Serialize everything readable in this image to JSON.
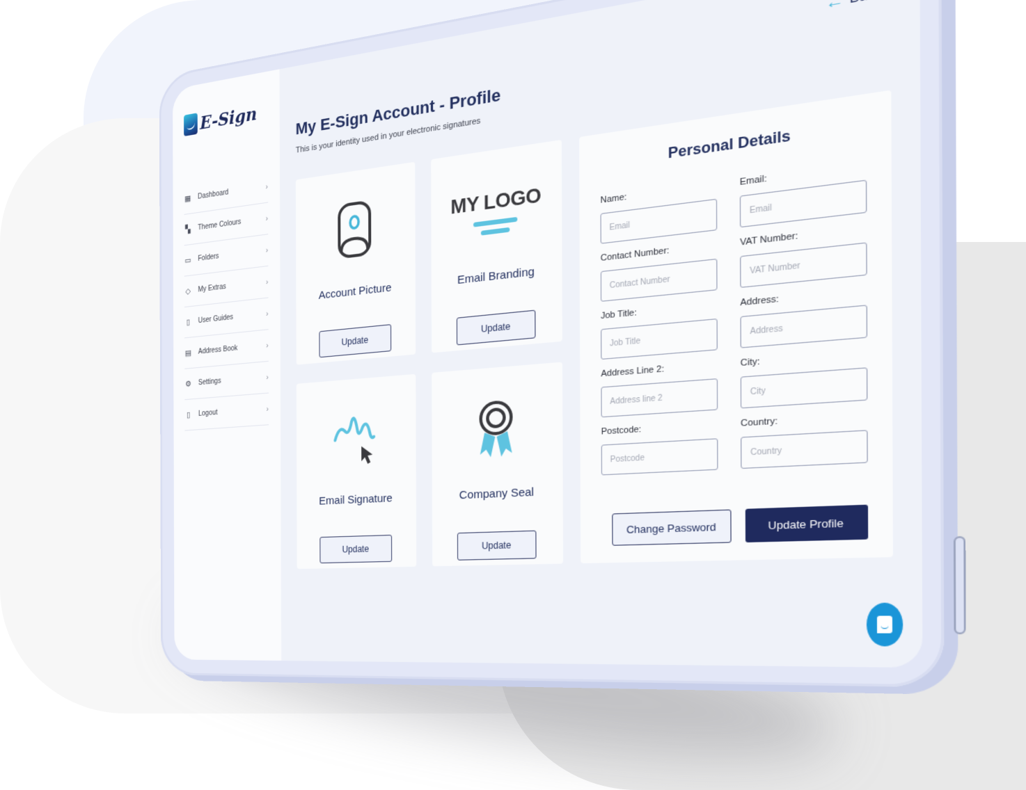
{
  "app": {
    "logo_text": "E-Sign"
  },
  "sidebar": {
    "items": [
      {
        "label": "Dashboard",
        "icon": "dashboard-icon"
      },
      {
        "label": "Theme Colours",
        "icon": "palette-icon"
      },
      {
        "label": "Folders",
        "icon": "folder-icon"
      },
      {
        "label": "My Extras",
        "icon": "tag-icon"
      },
      {
        "label": "User Guides",
        "icon": "book-icon"
      },
      {
        "label": "Address Book",
        "icon": "address-book-icon"
      },
      {
        "label": "Settings",
        "icon": "gear-icon"
      },
      {
        "label": "Logout",
        "icon": "logout-icon"
      }
    ]
  },
  "header": {
    "back_label": "Back",
    "title": "My E-Sign Account - Profile",
    "subtitle": "This is your identity used in your electronic signatures"
  },
  "cards": [
    {
      "title": "Account Picture",
      "button": "Update",
      "icon": "account-picture-icon"
    },
    {
      "title": "Email Branding",
      "button": "Update",
      "icon": "logo-icon",
      "logo_text": "MY LOGO"
    },
    {
      "title": "Email Signature",
      "button": "Update",
      "icon": "signature-icon"
    },
    {
      "title": "Company Seal",
      "button": "Update",
      "icon": "seal-icon"
    }
  ],
  "personal_details": {
    "title": "Personal Details",
    "fields": [
      {
        "label": "Name:",
        "placeholder": "Email",
        "value": ""
      },
      {
        "label": "Email:",
        "placeholder": "Email",
        "value": ""
      },
      {
        "label": "Contact Number:",
        "placeholder": "Contact Number",
        "value": ""
      },
      {
        "label": "VAT Number:",
        "placeholder": "VAT Number",
        "value": ""
      },
      {
        "label": "Job Title:",
        "placeholder": "Job Title",
        "value": ""
      },
      {
        "label": "Address:",
        "placeholder": "Address",
        "value": ""
      },
      {
        "label": "Address Line 2:",
        "placeholder": "Address line 2",
        "value": ""
      },
      {
        "label": "City:",
        "placeholder": "City",
        "value": ""
      },
      {
        "label": "Postcode:",
        "placeholder": "Postcode",
        "value": ""
      },
      {
        "label": "Country:",
        "placeholder": "Country",
        "value": ""
      }
    ],
    "change_password_label": "Change Password",
    "update_profile_label": "Update Profile"
  },
  "colors": {
    "navy": "#1f2a5e",
    "accent_cyan": "#5ec3e0",
    "chat_blue": "#1a95d8",
    "screen_bg": "#eff2f9"
  }
}
